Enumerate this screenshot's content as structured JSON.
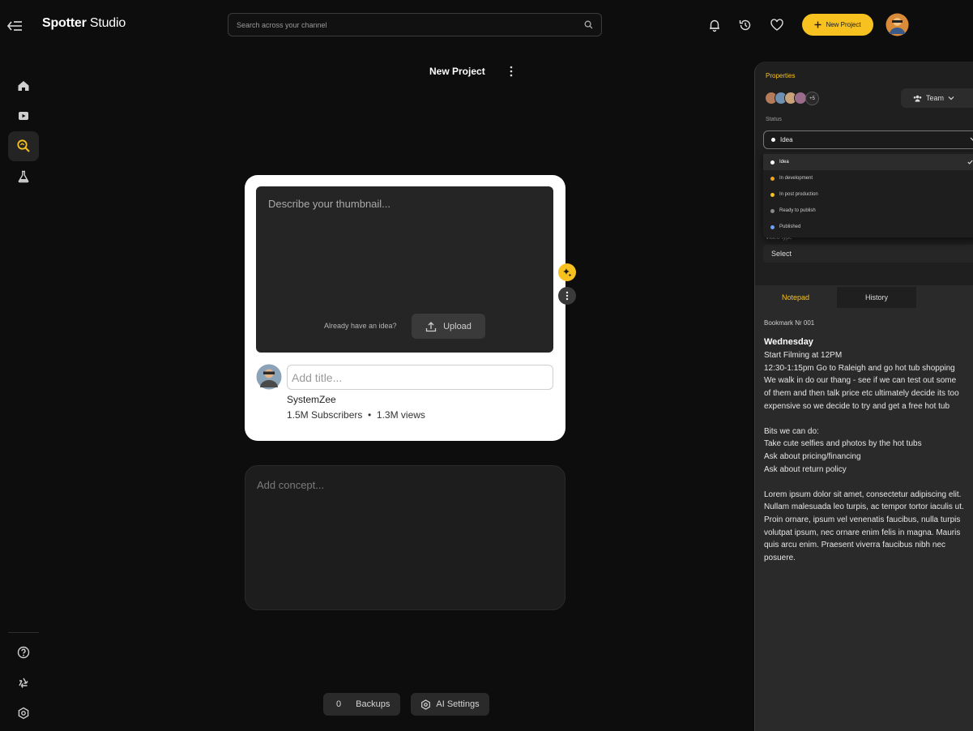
{
  "header": {
    "brand_bold": "Spotter",
    "brand_rest": " Studio",
    "search_placeholder": "Search across your channel",
    "new_project_label": "New Project"
  },
  "sidebar": {
    "items": [
      {
        "icon": "home-icon"
      },
      {
        "icon": "youtube-icon"
      },
      {
        "icon": "search-idea-icon",
        "active": true
      },
      {
        "icon": "flask-icon"
      }
    ],
    "bottom_items": [
      {
        "icon": "help-icon"
      },
      {
        "icon": "recycle-icon"
      },
      {
        "icon": "settings-icon"
      }
    ]
  },
  "project": {
    "title": "New Project",
    "thumbnail_placeholder": "Describe your thumbnail...",
    "upload_prompt": "Already have an idea?",
    "upload_label": "Upload",
    "title_placeholder": "Add title...",
    "channel_name": "SystemZee",
    "channel_stats": "1.5M Subscribers  •  1.3M views",
    "concept_placeholder": "Add concept..."
  },
  "footer": {
    "backups_count": "0",
    "backups_label": "Backups",
    "ai_settings_label": "AI Settings"
  },
  "properties": {
    "title": "Properties",
    "member_more": "+5",
    "team_label": "Team",
    "status_label": "Status",
    "status_value": "Idea",
    "status_options": [
      {
        "label": "Idea",
        "color": "#ffffff",
        "selected": true
      },
      {
        "label": "In development",
        "color": "#f7a21f"
      },
      {
        "label": "In post production",
        "color": "#f7c21f"
      },
      {
        "label": "Ready to publish",
        "color": "#8a8a8a"
      },
      {
        "label": "Published",
        "color": "#6aa0ff"
      }
    ],
    "video_type_label": "Video type",
    "video_type_value": "Select"
  },
  "notepad": {
    "tabs": [
      "Notepad",
      "History"
    ],
    "bookmark": "Bookmark Nr 001",
    "day": "Wednesday",
    "lines": [
      "Start Filming at 12PM",
      "12:30-1:15pm Go to Raleigh and go hot tub shopping",
      "We walk in do our thang - see if we can test out some",
      "of them and then talk price etc ultimately decide its too",
      "expensive so we decide to try and get a free hot tub"
    ],
    "bits_title": "Bits we can do:",
    "bits": [
      "Take cute selfies and photos by the hot tubs",
      "Ask about pricing/financing",
      "Ask about return policy"
    ],
    "lorem": [
      "Lorem ipsum dolor sit amet, consectetur adipiscing elit.",
      "Nullam malesuada leo turpis, ac tempor tortor iaculis ut.",
      "Proin ornare, ipsum vel venenatis faucibus, nulla turpis",
      "volutpat ipsum, nec ornare enim felis in magna. Mauris",
      "quis arcu enim. Praesent viverra faucibus nibh nec",
      "posuere."
    ]
  },
  "colors": {
    "accent": "#f7c21f",
    "background": "#0d0d0d",
    "panel": "#2a2a2a"
  }
}
